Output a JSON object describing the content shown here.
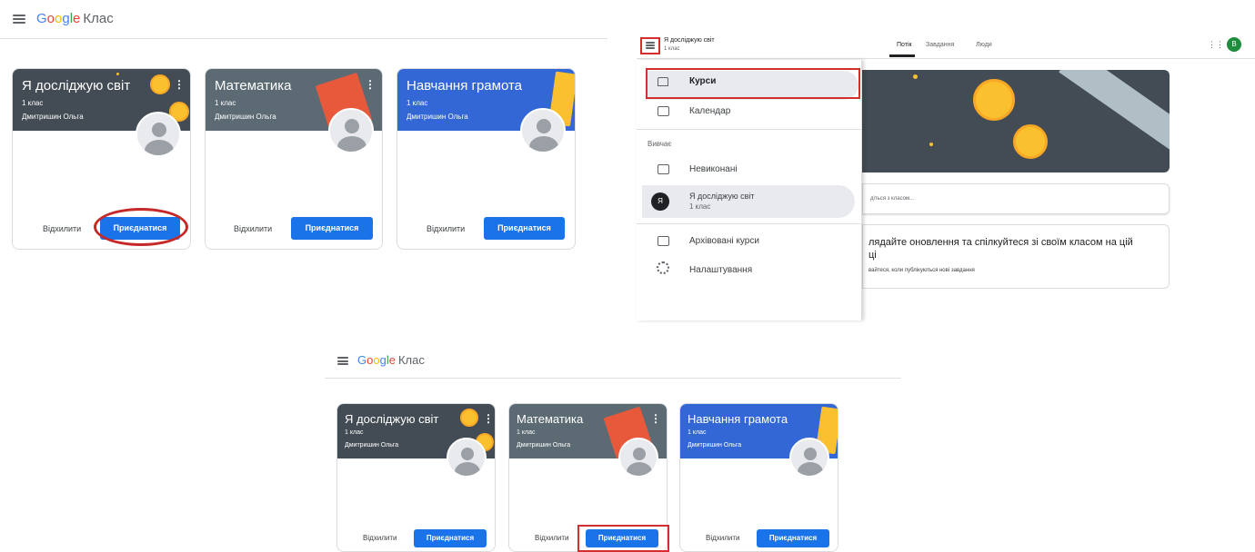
{
  "app": {
    "brand": "Google",
    "product": "Клас"
  },
  "course_list": {
    "courses": [
      {
        "title": "Я досліджую світ",
        "section": "1 клас",
        "teacher": "Дмитришин Ольга",
        "color": "#434c54"
      },
      {
        "title": "Математика",
        "section": "1 клас",
        "teacher": "Дмитришин Ольга",
        "color": "#5c6b73"
      },
      {
        "title": "Навчання грамота",
        "section": "1 клас",
        "teacher": "Дмитришин Ольга",
        "color": "#3367d6"
      }
    ],
    "decline_label": "Відхилити",
    "join_label": "Приєднатися"
  },
  "class_page": {
    "title": "Я досліджую світ",
    "subtitle": "1 клас",
    "tabs": [
      "Потік",
      "Завдання",
      "Люди"
    ],
    "account_initial": "В",
    "announce_placeholder": "діться з класом...",
    "stream_heading": "лядайте оновлення та спілкуйтеся зі своїм класом на цій",
    "stream_heading2": "ці",
    "stream_sub": "вайтеся, коли публікуються нові завдання"
  },
  "nav_menu": {
    "courses": "Курси",
    "calendar": "Календар",
    "studying": "Вивчає",
    "todo": "Невиконані",
    "course_title": "Я досліджую світ",
    "course_section": "1 клас",
    "course_avatar": "Я",
    "archived": "Архівовані курси",
    "settings": "Налаштування"
  },
  "colors": {
    "accent": "#1a73e8",
    "highlight": "#d32f2f",
    "account": "#1e8e3e"
  }
}
